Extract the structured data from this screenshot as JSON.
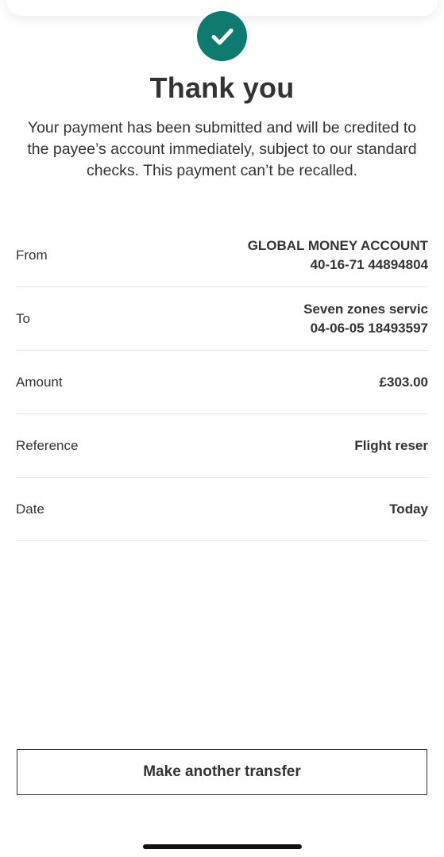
{
  "confirmation": {
    "title": "Thank you",
    "message": "Your payment has been submitted and will be credited to the payee’s account immediately, subject to our standard checks. This payment can’t be recalled."
  },
  "details": {
    "from": {
      "label": "From",
      "account_name": "GLOBAL MONEY ACCOUNT",
      "account_number": "40-16-71 44894804"
    },
    "to": {
      "label": "To",
      "payee_name": "Seven zones servic",
      "account_number": "04-06-05 18493597"
    },
    "amount": {
      "label": "Amount",
      "value": "£303.00"
    },
    "reference": {
      "label": "Reference",
      "value": "Flight reser"
    },
    "date": {
      "label": "Date",
      "value": "Today"
    }
  },
  "actions": {
    "make_another_transfer": "Make another transfer"
  },
  "colors": {
    "accent": "#0f7a70",
    "text": "#333333",
    "divider": "#e6e6e6"
  },
  "icons": {
    "success": "checkmark-icon"
  }
}
